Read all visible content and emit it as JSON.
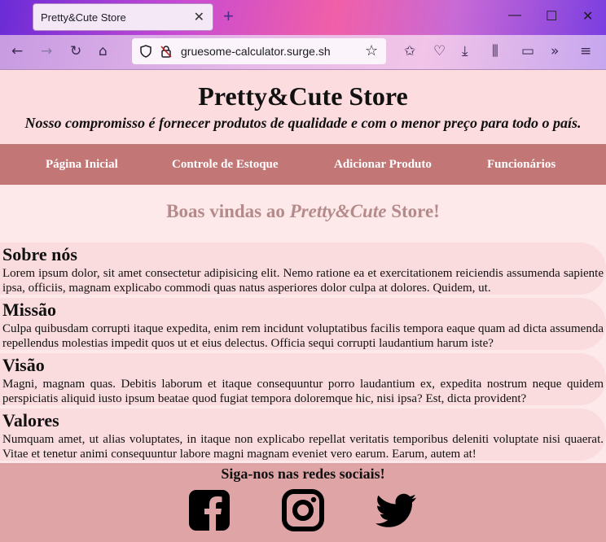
{
  "browser": {
    "tab_title": "Pretty&Cute Store",
    "tab_close": "✕",
    "new_tab": "+",
    "url": "gruesome-calculator.surge.sh"
  },
  "header": {
    "title": "Pretty&Cute Store",
    "tagline": "Nosso compromisso é fornecer produtos de qualidade e com o menor preço para todo o país."
  },
  "menu": {
    "items": [
      "Página Inicial",
      "Controle de Estoque",
      "Adicionar Produto",
      "Funcionários"
    ]
  },
  "welcome": {
    "prefix": "Boas vindas ao ",
    "brand": "Pretty&Cute",
    "suffix": " Store!"
  },
  "sections": [
    {
      "title": "Sobre nós",
      "text": "Lorem ipsum dolor, sit amet consectetur adipisicing elit. Nemo ratione ea et exercitationem reiciendis assumenda sapiente ipsa, officiis, magnam explicabo commodi quas natus asperiores dolor culpa at dolores. Quidem, ut."
    },
    {
      "title": "Missão",
      "text": "Culpa quibusdam corrupti itaque expedita, enim rem incidunt voluptatibus facilis tempora eaque quam ad dicta assumenda repellendus molestias impedit quos ut et eius delectus. Officia sequi corrupti laudantium harum iste?"
    },
    {
      "title": "Visão",
      "text": "Magni, magnam quas. Debitis laborum et itaque consequuntur porro laudantium ex, expedita nostrum neque quidem perspiciatis aliquid iusto ipsum beatae quod fugiat tempora doloremque hic, nisi ipsa? Est, dicta provident?"
    },
    {
      "title": "Valores",
      "text": "Numquam amet, ut alias voluptates, in itaque non explicabo repellat veritatis temporibus deleniti voluptate nisi quaerat. Vitae et tenetur animi consequuntur labore magni magnam eveniet vero earum. Earum, autem at!"
    }
  ],
  "footer": {
    "title": "Siga-nos nas redes sociais!",
    "icons": [
      "facebook-icon",
      "instagram-icon",
      "twitter-icon"
    ]
  },
  "colors": {
    "header_bg": "#fcdcdf",
    "menu_bg": "#c27676",
    "content_bg": "#fde9ea",
    "section_bg": "#fadcde",
    "footer_bg": "#dfa5a6",
    "welcome_text": "#b58a8a"
  }
}
